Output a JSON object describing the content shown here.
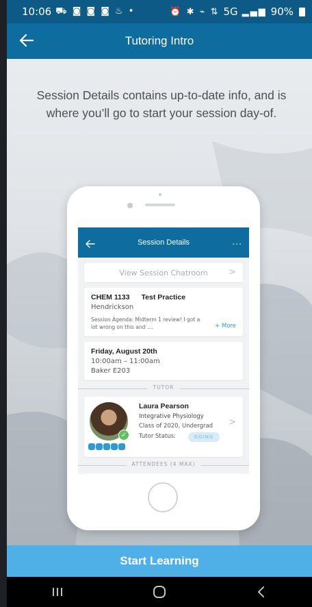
{
  "status_bar": {
    "time": "10:06",
    "notification_icons": "notification-icons",
    "system_icons": "5G",
    "battery": "90%"
  },
  "app_bar": {
    "title": "Tutoring Intro"
  },
  "intro_text": "Session Details contains up-to-date info, and is where you’ll go to start your session day-of.",
  "mockup": {
    "header_title": "Session Details",
    "more_label": "...",
    "chatroom_label": "View Session Chatroom",
    "course": {
      "code": "CHEM 1133",
      "type": "Test Practice",
      "professor": "Hendrickson",
      "agenda": "Session Agenda: Midterm 1 review! I got a lot wrong on this and ....",
      "more_link": "+ More"
    },
    "schedule": {
      "date": "Friday, August 20th",
      "time": "10:00am – 11:00am",
      "location": "Baker E203"
    },
    "tutor_section_label": "TUTOR",
    "tutor": {
      "name": "Laura Pearson",
      "major": "Integrative Physiology",
      "class_info": "Class of 2020, Undergrad",
      "status_label": "Tutor Status:",
      "status_value": "GOING",
      "rating": 5
    },
    "attendees_label": "ATTENDEES (4 MAX)"
  },
  "cta_label": "Start Learning",
  "colors": {
    "app_bar": "#0e6c9f",
    "status_bar": "#0d5a86",
    "cta": "#4fb0e7",
    "accent": "#2f9bd6"
  }
}
